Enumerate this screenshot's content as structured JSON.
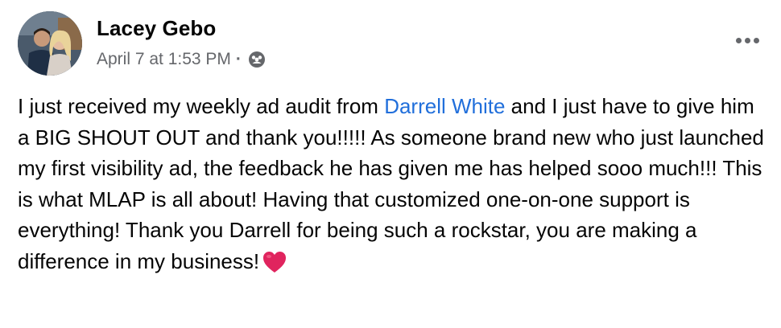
{
  "post": {
    "author": "Lacey Gebo",
    "timestamp": "April 7 at 1:53 PM",
    "separator": "·",
    "audience_icon": "group-audience-icon",
    "more_icon": "more-options-icon",
    "text_before_mention": "I just received my weekly ad audit from ",
    "mention": "Darrell White",
    "text_after_mention": " and I just have to give him a BIG SHOUT OUT and thank you!!!!! As someone brand new who just launched my first visibility ad, the feedback he has given me has helped sooo much!!! This is what MLAP is all about! Having that customized one-on-one support is everything! Thank you Darrell for being such a rockstar, you are making a difference in my business!",
    "emoji": "heart-icon"
  },
  "colors": {
    "mention": "#216fdb",
    "meta": "#65676b",
    "text": "#050505",
    "heart": "#e0245e"
  }
}
